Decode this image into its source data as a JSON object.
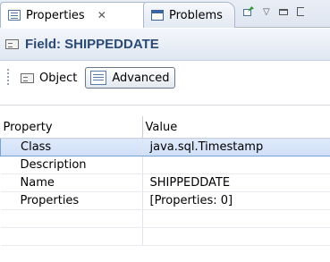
{
  "tabs": [
    {
      "label": "Properties",
      "icon": "properties-icon",
      "active": true
    },
    {
      "label": "Problems",
      "icon": "problems-icon",
      "active": false
    }
  ],
  "header": {
    "title": "Field: SHIPPEDDATE"
  },
  "modes": [
    {
      "label": "Object",
      "selected": false
    },
    {
      "label": "Advanced",
      "selected": true
    }
  ],
  "table": {
    "columns": [
      "Property",
      "Value"
    ],
    "rows": [
      {
        "property": "Class",
        "value": "java.sql.Timestamp"
      },
      {
        "property": "Description",
        "value": ""
      },
      {
        "property": "Name",
        "value": "SHIPPEDDATE"
      },
      {
        "property": "Properties",
        "value": "[Properties: 0]"
      }
    ]
  },
  "colors": {
    "accent": "#2b4a75",
    "selection": "#cfdff7"
  }
}
